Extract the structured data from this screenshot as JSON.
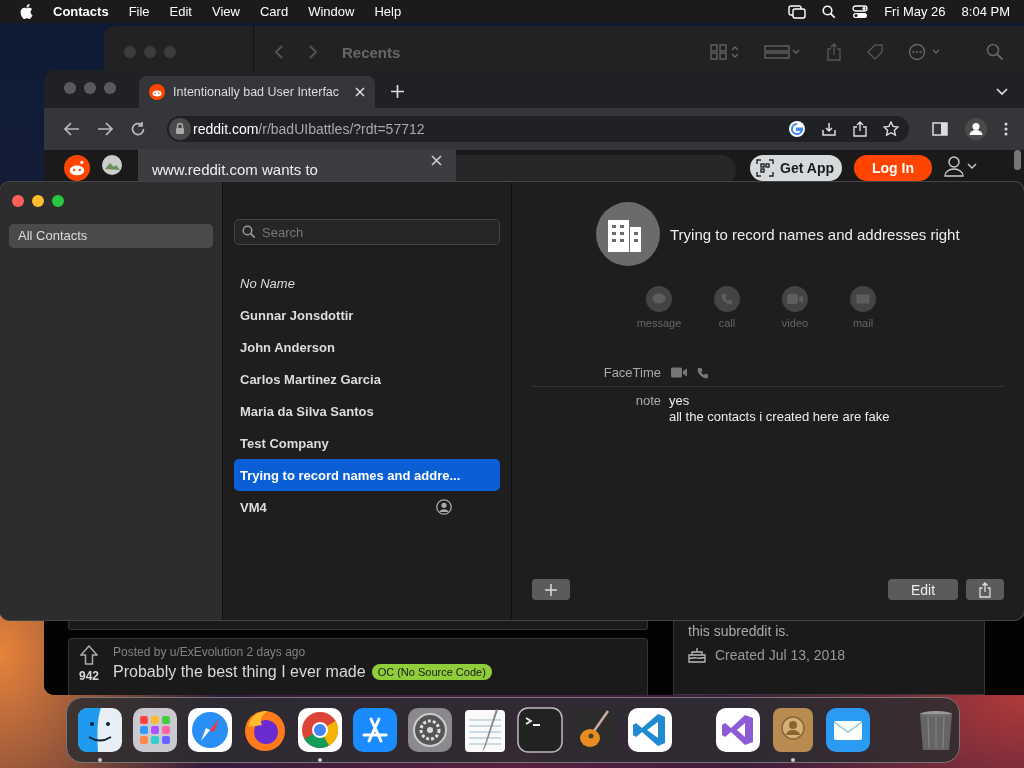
{
  "menu_bar": {
    "app_name": "Contacts",
    "menus": [
      "File",
      "Edit",
      "View",
      "Card",
      "Window",
      "Help"
    ],
    "date": "Fri May 26",
    "time": "8:04 PM"
  },
  "back_window": {
    "title": "Recents"
  },
  "browser": {
    "tabs": [
      {
        "title": "Intentionally bad User Interfac",
        "selected": true
      }
    ],
    "address": {
      "host": "reddit.com",
      "path": "/r/badUIbattles/?rdt=57712"
    },
    "popup": {
      "text": "www.reddit.com wants to"
    },
    "header_buttons": [
      {
        "label": "Get App",
        "kind": "app"
      },
      {
        "label": "Log In",
        "kind": "login"
      }
    ],
    "post": {
      "meta": "Posted by u/ExEvolution 2 days ago",
      "votes": "942",
      "title": "Probably the best thing I ever made",
      "flair": "OC (No Source Code)"
    },
    "sidebar": {
      "text": "this subreddit is.",
      "created": "Created Jul 13, 2018"
    }
  },
  "contacts": {
    "groups": [
      {
        "label": "All Contacts",
        "selected": true
      }
    ],
    "search": {
      "placeholder": "Search"
    },
    "list": [
      {
        "name": "No Name",
        "kind": "unnamed",
        "selected": false
      },
      {
        "name": "Gunnar Jonsdottir",
        "kind": "person",
        "selected": false
      },
      {
        "name": "John Anderson",
        "kind": "person",
        "selected": false
      },
      {
        "name": "Carlos Martinez Garcia",
        "kind": "person",
        "selected": false
      },
      {
        "name": "Maria da Silva Santos",
        "kind": "person",
        "selected": false
      },
      {
        "name": "Test Company",
        "kind": "person",
        "selected": false
      },
      {
        "name": "Trying to record names and addre...",
        "kind": "person",
        "selected": true
      },
      {
        "name": "VM4",
        "kind": "me",
        "selected": false
      }
    ],
    "card": {
      "name": "Trying to record names and addresses right",
      "actions": [
        {
          "label": "message",
          "kind": "message",
          "disabled": true
        },
        {
          "label": "call",
          "kind": "call",
          "disabled": true
        },
        {
          "label": "video",
          "kind": "video",
          "disabled": true
        },
        {
          "label": "mail",
          "kind": "mail",
          "disabled": true
        }
      ],
      "fields": [
        {
          "label": "FaceTime",
          "kind": "facetime"
        },
        {
          "label": "note",
          "kind": "note",
          "lines": [
            "yes",
            "all the contacts i created here are fake"
          ]
        }
      ],
      "edit_button": "Edit"
    }
  },
  "dock": {
    "items": [
      {
        "kind": "finder",
        "running": true
      },
      {
        "kind": "launchpad",
        "running": false
      },
      {
        "kind": "safari",
        "running": false
      },
      {
        "kind": "firefox",
        "running": false
      },
      {
        "kind": "chrome",
        "running": true
      },
      {
        "kind": "appstore",
        "running": false
      },
      {
        "kind": "settings",
        "running": false
      },
      {
        "kind": "textedit",
        "running": false
      },
      {
        "kind": "terminal",
        "running": false
      },
      {
        "kind": "guitar",
        "running": false
      },
      {
        "kind": "vscode",
        "running": false
      },
      {
        "kind": "separator"
      },
      {
        "kind": "visualstudio",
        "running": false
      },
      {
        "kind": "contacts",
        "running": true
      },
      {
        "kind": "mail",
        "running": false
      },
      {
        "kind": "separator"
      },
      {
        "kind": "trash",
        "running": false
      }
    ]
  }
}
